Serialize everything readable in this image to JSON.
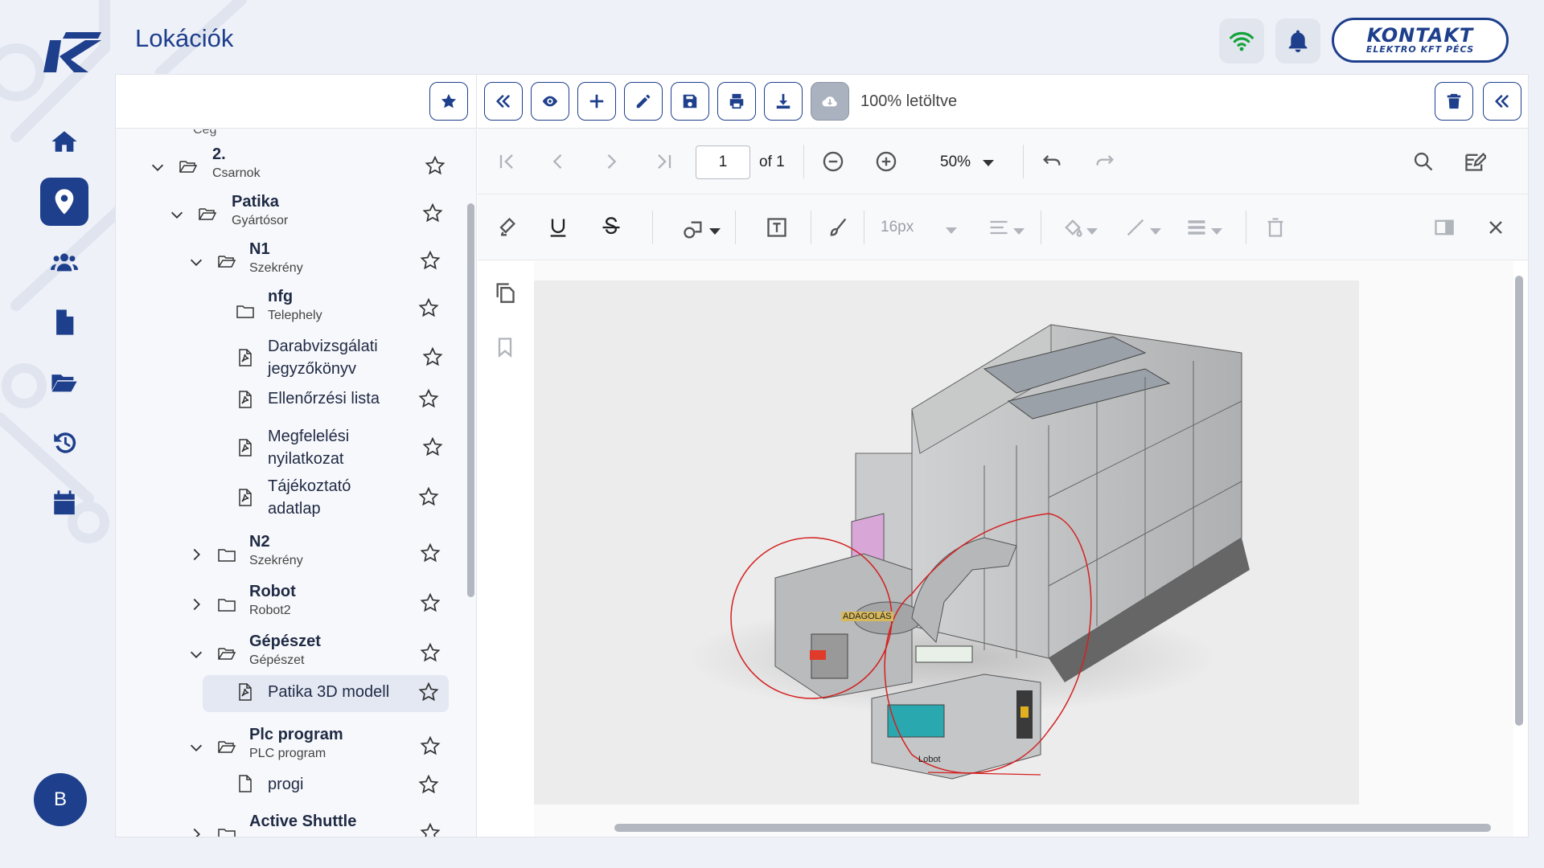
{
  "app": {
    "page_title": "Lokációk",
    "user_initial": "B",
    "brand_line1": "KONTAKT",
    "brand_line2": "ELEKTRO KFT PÉCS"
  },
  "nav": [
    {
      "icon": "home-icon",
      "active": false
    },
    {
      "icon": "location-pin-icon",
      "active": true
    },
    {
      "icon": "users-icon",
      "active": false
    },
    {
      "icon": "document-icon",
      "active": false
    },
    {
      "icon": "folder-open-icon",
      "active": false
    },
    {
      "icon": "history-icon",
      "active": false
    },
    {
      "icon": "calendar-icon",
      "active": false
    }
  ],
  "tree": {
    "partial_top": "Cég",
    "items": [
      {
        "title": "2.",
        "subtitle": "Csarnok",
        "type": "folder-open",
        "expanded": true
      },
      {
        "title": "Patika",
        "subtitle": "Gyártósor",
        "type": "folder-open",
        "expanded": true
      },
      {
        "title": "N1",
        "subtitle": "Szekrény",
        "type": "folder-open",
        "expanded": true
      },
      {
        "title": "nfg",
        "subtitle": "Telephely",
        "type": "folder"
      },
      {
        "title": "Darabvizsgálati jegyzőkönyv",
        "type": "pdf"
      },
      {
        "title": "Ellenőrzési lista",
        "type": "pdf"
      },
      {
        "title": "Megfelelési nyilatkozat",
        "type": "pdf"
      },
      {
        "title": "Tájékoztató adatlap",
        "type": "pdf"
      },
      {
        "title": "N2",
        "subtitle": "Szekrény",
        "type": "folder",
        "expanded": false
      },
      {
        "title": "Robot",
        "subtitle": "Robot2",
        "type": "folder",
        "expanded": false
      },
      {
        "title": "Gépészet",
        "subtitle": "Gépészet",
        "type": "folder-open",
        "expanded": true
      },
      {
        "title": "Patika 3D modell",
        "type": "pdf",
        "selected": true
      },
      {
        "title": "Plc program",
        "subtitle": "PLC program",
        "type": "folder-open",
        "expanded": true
      },
      {
        "title": "progi",
        "type": "file"
      },
      {
        "title": "Active Shuttle",
        "type": "folder",
        "expanded": false
      }
    ]
  },
  "viewer": {
    "download_status": "100% letöltve",
    "page_current": "1",
    "page_of": "of 1",
    "zoom": "50%",
    "font_size": "16px",
    "drawing_labels": {
      "adagolas": "ADAGOLÁS",
      "lobot": "Lobot"
    }
  }
}
